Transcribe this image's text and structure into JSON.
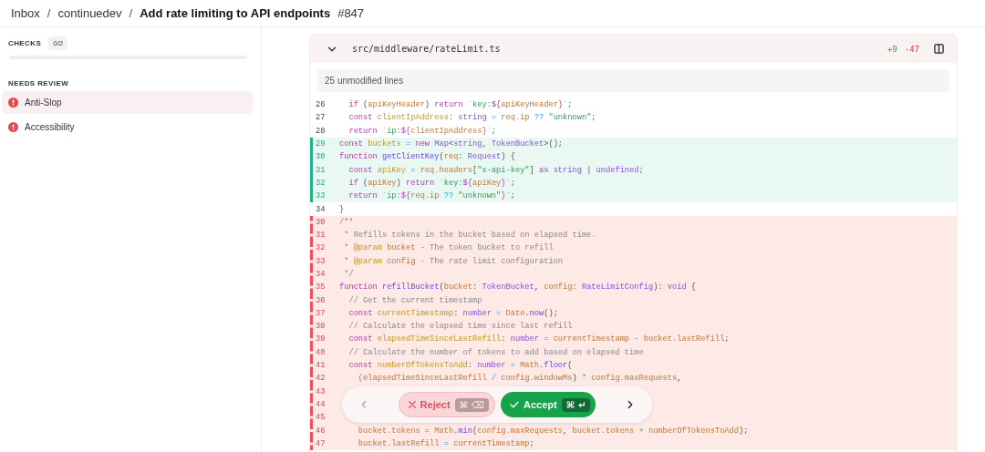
{
  "breadcrumb": [
    {
      "kind": "link",
      "text": "Inbox"
    },
    {
      "kind": "separator",
      "text": "/"
    },
    {
      "kind": "link",
      "text": "continuedev"
    },
    {
      "kind": "separator",
      "text": "/"
    },
    {
      "kind": "title",
      "text": "Add rate limiting to API endpoints"
    },
    {
      "kind": "number",
      "text": "#847"
    }
  ],
  "sidebar": {
    "checks_label": "CHECKS",
    "checks_count": "0/2",
    "checks_progress": {
      "level": 0
    },
    "section_label": "NEEDS REVIEW",
    "items": [
      {
        "label": "Anti-Slop",
        "selected": true
      },
      {
        "label": "Accessibility",
        "selected": false
      }
    ]
  },
  "diff": {
    "file": "src/middleware/rateLimit.ts",
    "expanded": true,
    "additions": "+9",
    "deletions": "-47",
    "collapsed_note": "25 unmodified lines",
    "lines": [
      {
        "number": "26",
        "kind": "context",
        "segments": [
          {
            "kind": "k",
            "text": "  if "
          },
          {
            "kind": "p",
            "text": "("
          },
          {
            "kind": "v",
            "text": "apiKeyHeader"
          },
          {
            "kind": "p",
            "text": ") "
          },
          {
            "kind": "k",
            "text": "return "
          },
          {
            "kind": "s",
            "text": "`key:"
          },
          {
            "kind": "k",
            "text": "${"
          },
          {
            "kind": "v",
            "text": "apiKeyHeader"
          },
          {
            "kind": "k",
            "text": "}"
          },
          {
            "kind": "s",
            "text": "`"
          },
          {
            "kind": "p",
            "text": ";"
          }
        ]
      },
      {
        "number": "27",
        "kind": "context",
        "segments": [
          {
            "kind": "k",
            "text": "  const "
          },
          {
            "kind": "d",
            "text": "clientIpAddress"
          },
          {
            "kind": "p",
            "text": ": "
          },
          {
            "kind": "t",
            "text": "string"
          },
          {
            "kind": "o",
            "text": " = "
          },
          {
            "kind": "v",
            "text": "req.ip "
          },
          {
            "kind": "o",
            "text": "?? "
          },
          {
            "kind": "s",
            "text": "\"unknown\""
          },
          {
            "kind": "p",
            "text": ";"
          }
        ]
      },
      {
        "number": "28",
        "kind": "context",
        "segments": [
          {
            "kind": "k",
            "text": "  return "
          },
          {
            "kind": "s",
            "text": "`ip:"
          },
          {
            "kind": "k",
            "text": "${"
          },
          {
            "kind": "v",
            "text": "clientIpAddress"
          },
          {
            "kind": "k",
            "text": "}"
          },
          {
            "kind": "s",
            "text": "`"
          },
          {
            "kind": "p",
            "text": ";"
          }
        ]
      },
      {
        "number": "29",
        "kind": "added",
        "segments": [
          {
            "kind": "k",
            "text": "const "
          },
          {
            "kind": "d",
            "text": "buckets"
          },
          {
            "kind": "o",
            "text": " = "
          },
          {
            "kind": "k",
            "text": "new "
          },
          {
            "kind": "t",
            "text": "Map"
          },
          {
            "kind": "p",
            "text": "<"
          },
          {
            "kind": "t",
            "text": "string"
          },
          {
            "kind": "p",
            "text": ", "
          },
          {
            "kind": "t",
            "text": "TokenBucket"
          },
          {
            "kind": "p",
            "text": ">();"
          }
        ]
      },
      {
        "number": "30",
        "kind": "added",
        "segments": [
          {
            "kind": "k",
            "text": "function "
          },
          {
            "kind": "f",
            "text": "getClientKey"
          },
          {
            "kind": "p",
            "text": "("
          },
          {
            "kind": "v",
            "text": "req"
          },
          {
            "kind": "p",
            "text": ": "
          },
          {
            "kind": "t",
            "text": "Request"
          },
          {
            "kind": "p",
            "text": ") {"
          }
        ]
      },
      {
        "number": "31",
        "kind": "added",
        "segments": [
          {
            "kind": "k",
            "text": "  const "
          },
          {
            "kind": "d",
            "text": "apiKey"
          },
          {
            "kind": "o",
            "text": " = "
          },
          {
            "kind": "v",
            "text": "req.headers"
          },
          {
            "kind": "p",
            "text": "["
          },
          {
            "kind": "s",
            "text": "\"x-api-key\""
          },
          {
            "kind": "p",
            "text": "] "
          },
          {
            "kind": "k",
            "text": "as "
          },
          {
            "kind": "t",
            "text": "string"
          },
          {
            "kind": "p",
            "text": " | "
          },
          {
            "kind": "t",
            "text": "undefined"
          },
          {
            "kind": "p",
            "text": ";"
          }
        ]
      },
      {
        "number": "32",
        "kind": "added",
        "segments": [
          {
            "kind": "k",
            "text": "  if "
          },
          {
            "kind": "p",
            "text": "("
          },
          {
            "kind": "v",
            "text": "apiKey"
          },
          {
            "kind": "p",
            "text": ") "
          },
          {
            "kind": "k",
            "text": "return "
          },
          {
            "kind": "s",
            "text": "`key:"
          },
          {
            "kind": "k",
            "text": "${"
          },
          {
            "kind": "v",
            "text": "apiKey"
          },
          {
            "kind": "k",
            "text": "}"
          },
          {
            "kind": "s",
            "text": "`"
          },
          {
            "kind": "p",
            "text": ";"
          }
        ]
      },
      {
        "number": "33",
        "kind": "added",
        "segments": [
          {
            "kind": "k",
            "text": "  return "
          },
          {
            "kind": "s",
            "text": "`ip:"
          },
          {
            "kind": "k",
            "text": "${"
          },
          {
            "kind": "v",
            "text": "req.ip "
          },
          {
            "kind": "o",
            "text": "?? "
          },
          {
            "kind": "s",
            "text": "\"unknown\""
          },
          {
            "kind": "k",
            "text": "}"
          },
          {
            "kind": "s",
            "text": "`"
          },
          {
            "kind": "p",
            "text": ";"
          }
        ]
      },
      {
        "number": "34",
        "kind": "context",
        "segments": [
          {
            "kind": "p",
            "text": "}"
          }
        ]
      },
      {
        "number": "30",
        "kind": "removed",
        "segments": [
          {
            "kind": "c",
            "text": "/**"
          }
        ]
      },
      {
        "number": "31",
        "kind": "removed",
        "segments": [
          {
            "kind": "c",
            "text": " * Refills tokens in the bucket based on elapsed time."
          }
        ]
      },
      {
        "number": "32",
        "kind": "removed",
        "segments": [
          {
            "kind": "c",
            "text": " * "
          },
          {
            "kind": "d",
            "text": "@param "
          },
          {
            "kind": "v",
            "text": "bucket"
          },
          {
            "kind": "c",
            "text": " - The token bucket to refill"
          }
        ]
      },
      {
        "number": "33",
        "kind": "removed",
        "segments": [
          {
            "kind": "c",
            "text": " * "
          },
          {
            "kind": "d",
            "text": "@param "
          },
          {
            "kind": "v",
            "text": "config"
          },
          {
            "kind": "c",
            "text": " - The rate limit configuration"
          }
        ]
      },
      {
        "number": "34",
        "kind": "removed",
        "segments": [
          {
            "kind": "c",
            "text": " */"
          }
        ]
      },
      {
        "number": "35",
        "kind": "removed",
        "segments": [
          {
            "kind": "k",
            "text": "function "
          },
          {
            "kind": "f",
            "text": "refillBucket"
          },
          {
            "kind": "p",
            "text": "("
          },
          {
            "kind": "v",
            "text": "bucket"
          },
          {
            "kind": "p",
            "text": ": "
          },
          {
            "kind": "t",
            "text": "TokenBucket"
          },
          {
            "kind": "p",
            "text": ", "
          },
          {
            "kind": "v",
            "text": "config"
          },
          {
            "kind": "p",
            "text": ": "
          },
          {
            "kind": "t",
            "text": "RateLimitConfig"
          },
          {
            "kind": "p",
            "text": "): "
          },
          {
            "kind": "t",
            "text": "void"
          },
          {
            "kind": "p",
            "text": " {"
          }
        ]
      },
      {
        "number": "36",
        "kind": "removed",
        "segments": [
          {
            "kind": "c",
            "text": "  // Get the current timestamp"
          }
        ]
      },
      {
        "number": "37",
        "kind": "removed",
        "segments": [
          {
            "kind": "k",
            "text": "  const "
          },
          {
            "kind": "d",
            "text": "currentTimestamp"
          },
          {
            "kind": "p",
            "text": ": "
          },
          {
            "kind": "t",
            "text": "number"
          },
          {
            "kind": "o",
            "text": " = "
          },
          {
            "kind": "v",
            "text": "Date"
          },
          {
            "kind": "p",
            "text": "."
          },
          {
            "kind": "f",
            "text": "now"
          },
          {
            "kind": "p",
            "text": "();"
          }
        ]
      },
      {
        "number": "38",
        "kind": "removed",
        "segments": [
          {
            "kind": "c",
            "text": "  // Calculate the elapsed time since last refill"
          }
        ]
      },
      {
        "number": "39",
        "kind": "removed",
        "segments": [
          {
            "kind": "k",
            "text": "  const "
          },
          {
            "kind": "d",
            "text": "elapsedTimeSinceLastRefill"
          },
          {
            "kind": "p",
            "text": ": "
          },
          {
            "kind": "t",
            "text": "number"
          },
          {
            "kind": "o",
            "text": " = "
          },
          {
            "kind": "v",
            "text": "currentTimestamp "
          },
          {
            "kind": "o",
            "text": "- "
          },
          {
            "kind": "v",
            "text": "bucket.lastRefill"
          },
          {
            "kind": "p",
            "text": ";"
          }
        ]
      },
      {
        "number": "40",
        "kind": "removed",
        "segments": [
          {
            "kind": "c",
            "text": "  // Calculate the number of tokens to add based on elapsed time"
          }
        ]
      },
      {
        "number": "41",
        "kind": "removed",
        "segments": [
          {
            "kind": "k",
            "text": "  const "
          },
          {
            "kind": "d",
            "text": "numberOfTokensToAdd"
          },
          {
            "kind": "p",
            "text": ": "
          },
          {
            "kind": "t",
            "text": "number"
          },
          {
            "kind": "o",
            "text": " = "
          },
          {
            "kind": "v",
            "text": "Math"
          },
          {
            "kind": "p",
            "text": "."
          },
          {
            "kind": "f",
            "text": "floor"
          },
          {
            "kind": "p",
            "text": "("
          }
        ]
      },
      {
        "number": "42",
        "kind": "removed",
        "segments": [
          {
            "kind": "v",
            "text": "    (elapsedTimeSinceLastRefill "
          },
          {
            "kind": "o",
            "text": "/ "
          },
          {
            "kind": "v",
            "text": "config.windowMs"
          },
          {
            "kind": "p",
            "text": ") "
          },
          {
            "kind": "o",
            "text": "* "
          },
          {
            "kind": "v",
            "text": "config.maxRequests"
          },
          {
            "kind": "p",
            "text": ","
          }
        ]
      },
      {
        "number": "43",
        "kind": "removed"
      },
      {
        "number": "44",
        "kind": "removed"
      },
      {
        "number": "45",
        "kind": "removed"
      },
      {
        "number": "46",
        "kind": "removed",
        "segments": [
          {
            "kind": "v",
            "text": "    bucket.tokens "
          },
          {
            "kind": "o",
            "text": "= "
          },
          {
            "kind": "v",
            "text": "Math"
          },
          {
            "kind": "p",
            "text": "."
          },
          {
            "kind": "f",
            "text": "min"
          },
          {
            "kind": "p",
            "text": "("
          },
          {
            "kind": "v",
            "text": "config.maxRequests"
          },
          {
            "kind": "p",
            "text": ", "
          },
          {
            "kind": "v",
            "text": "bucket.tokens "
          },
          {
            "kind": "o",
            "text": "+ "
          },
          {
            "kind": "v",
            "text": "numberOfTokensToAdd"
          },
          {
            "kind": "p",
            "text": ");"
          }
        ]
      },
      {
        "number": "47",
        "kind": "removed",
        "segments": [
          {
            "kind": "v",
            "text": "    bucket.lastRefill "
          },
          {
            "kind": "o",
            "text": "= "
          },
          {
            "kind": "v",
            "text": "currentTimestamp"
          },
          {
            "kind": "p",
            "text": ";"
          }
        ]
      }
    ]
  },
  "review_bar": {
    "previous": {
      "disabled": true
    },
    "next": {
      "disabled": false
    },
    "reject": {
      "label": "Reject",
      "keys": [
        "⌘",
        "⌫"
      ]
    },
    "accept": {
      "label": "Accept",
      "keys": [
        "⌘",
        "↵"
      ]
    }
  }
}
